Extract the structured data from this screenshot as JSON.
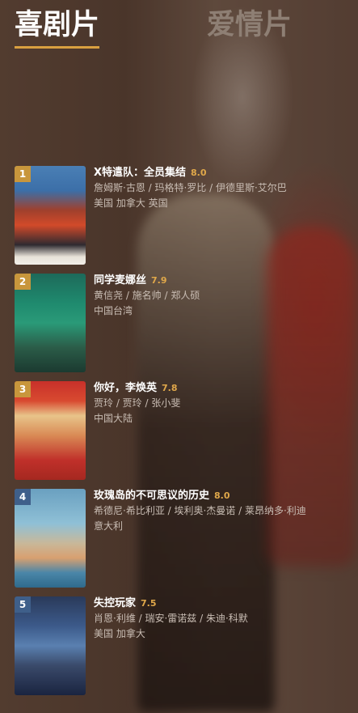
{
  "tabs": [
    {
      "label": "喜剧片",
      "active": true
    },
    {
      "label": "爱情片",
      "active": false
    }
  ],
  "colors": {
    "accent": "#d9a040",
    "score": "#e0a84a",
    "rank_gold": "#c8963c",
    "rank_blue": "#3f5f8a"
  },
  "movies": [
    {
      "rank": "1",
      "title": "X特遣队：全员集结",
      "score": "8.0",
      "cast": "詹姆斯·古恩 / 玛格特·罗比 / 伊德里斯·艾尔巴",
      "region": "美国 加拿大 英国"
    },
    {
      "rank": "2",
      "title": "同学麦娜丝",
      "score": "7.9",
      "cast": "黄信尧 / 施名帅 / 郑人硕",
      "region": "中国台湾"
    },
    {
      "rank": "3",
      "title": "你好，李焕英",
      "score": "7.8",
      "cast": "贾玲 / 贾玲 / 张小斐",
      "region": "中国大陆"
    },
    {
      "rank": "4",
      "title": "玫瑰岛的不可思议的历史",
      "score": "8.0",
      "cast": "希德尼·希比利亚 / 埃利奥·杰曼诺 / 莱昂纳多·利迪",
      "region": "意大利"
    },
    {
      "rank": "5",
      "title": "失控玩家",
      "score": "7.5",
      "cast": "肖恩·利维 / 瑞安·雷诺兹 / 朱迪·科默",
      "region": "美国 加拿大"
    }
  ]
}
